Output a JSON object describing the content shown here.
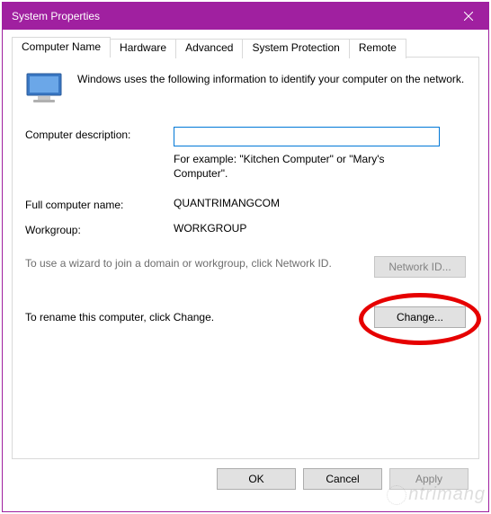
{
  "window": {
    "title": "System Properties"
  },
  "tabs": [
    {
      "label": "Computer Name"
    },
    {
      "label": "Hardware"
    },
    {
      "label": "Advanced"
    },
    {
      "label": "System Protection"
    },
    {
      "label": "Remote"
    }
  ],
  "intro": "Windows uses the following information to identify your computer on the network.",
  "descLabel": "Computer description:",
  "descValue": "",
  "exampleText": "For example: \"Kitchen Computer\" or \"Mary's Computer\".",
  "fullNameLabel": "Full computer name:",
  "fullNameValue": "QUANTRIMANGCOM",
  "workgroupLabel": "Workgroup:",
  "workgroupValue": "WORKGROUP",
  "wizardText": "To use a wizard to join a domain or workgroup, click Network ID.",
  "networkIdButton": "Network ID...",
  "renameText": "To rename this computer, click Change.",
  "changeButton": "Change...",
  "buttons": {
    "ok": "OK",
    "cancel": "Cancel",
    "apply": "Apply"
  },
  "watermark": "ntrimang"
}
